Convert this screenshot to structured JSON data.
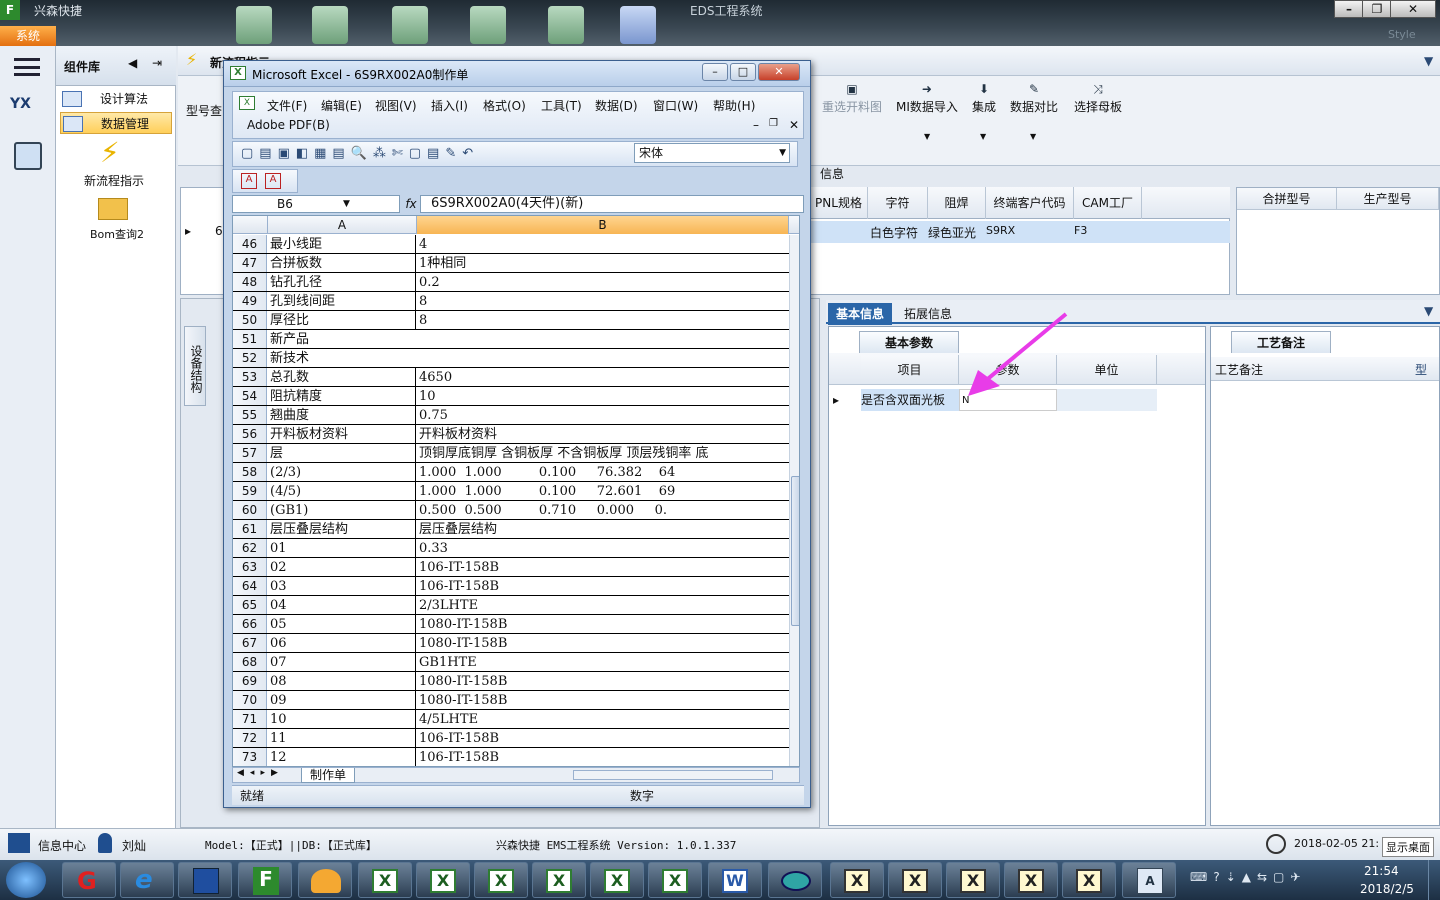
{
  "app": {
    "title": "兴森快捷",
    "center_title": "EDS工程系统",
    "system_button": "系统",
    "style_label": "Style"
  },
  "nav": {
    "library_title": "组件库",
    "items": [
      {
        "label": "设计算法"
      },
      {
        "label": "数据管理"
      }
    ],
    "new_flow": "新流程指示",
    "bom": "Bom查询2"
  },
  "main": {
    "tab_label": "新流程指示",
    "model_query": "型号查",
    "info_label": "信息",
    "ribbon": [
      {
        "label": "重选开料图",
        "icon": "image-icon",
        "disabled": true
      },
      {
        "label": "MI数据导入",
        "icon": "import-icon"
      },
      {
        "label": "集成",
        "icon": "download-icon"
      },
      {
        "label": "数据对比",
        "icon": "compare-icon"
      },
      {
        "label": "选择母板",
        "icon": "shuffle-icon"
      }
    ],
    "grid_headers": [
      "PNL规格",
      "字符",
      "阻焊",
      "终端客户代码",
      "CAM工厂"
    ],
    "grid_row": [
      "白色字符",
      "绿色亚光",
      "S9RX",
      "F3"
    ],
    "right_grid_headers": [
      "合拼型号",
      "生产型号"
    ],
    "side_tab": "设备结构",
    "row_marker_left": "6"
  },
  "detail": {
    "tabs": [
      "基本信息",
      "拓展信息"
    ],
    "left_subtab": "基本参数",
    "left_headers": [
      "项目",
      "参数",
      "单位"
    ],
    "left_row": {
      "item": "是否含双面光板",
      "param": "N",
      "unit": ""
    },
    "right_subtab": "工艺备注",
    "right_headers": [
      "工艺备注",
      "型"
    ]
  },
  "excel": {
    "title": "Microsoft Excel - 6S9RX002A0制作单",
    "menu": [
      "文件(F)",
      "编辑(E)",
      "视图(V)",
      "插入(I)",
      "格式(O)",
      "工具(T)",
      "数据(D)",
      "窗口(W)",
      "帮助(H)"
    ],
    "menu2": "Adobe PDF(B)",
    "font": "宋体",
    "namebox": "B6",
    "fx": "fx",
    "formula": "6S9RX002A0(4天件)(新)",
    "columns": [
      "A",
      "B"
    ],
    "rows": [
      {
        "n": "46",
        "a": "最小线距",
        "b": "4"
      },
      {
        "n": "47",
        "a": "合拼板数",
        "b": "1种相同"
      },
      {
        "n": "48",
        "a": "钻孔孔径",
        "b": "0.2"
      },
      {
        "n": "49",
        "a": "孔到线间距",
        "b": "8"
      },
      {
        "n": "50",
        "a": "厚径比",
        "b": "8"
      },
      {
        "n": "51",
        "a": "新产品",
        "b": "",
        "merged": true
      },
      {
        "n": "52",
        "a": "新技术",
        "b": "",
        "merged": true
      },
      {
        "n": "53",
        "a": "总孔数",
        "b": "4650"
      },
      {
        "n": "54",
        "a": "阻抗精度",
        "b": "10"
      },
      {
        "n": "55",
        "a": "翘曲度",
        "b": "0.75"
      },
      {
        "n": "56",
        "a": "开料板材资料",
        "b": "开料板材资料"
      },
      {
        "n": "57",
        "a": "层",
        "b": "顶铜厚底铜厚 含铜板厚 不含铜板厚 顶层残铜率 底"
      },
      {
        "n": "58",
        "a": "(2/3)",
        "b": "1.000  1.000         0.100     76.382    64"
      },
      {
        "n": "59",
        "a": "(4/5)",
        "b": "1.000  1.000         0.100     72.601    69"
      },
      {
        "n": "60",
        "a": "(GB1)",
        "b": "0.500  0.500         0.710     0.000     0."
      },
      {
        "n": "61",
        "a": "层压叠层结构",
        "b": "层压叠层结构"
      },
      {
        "n": "62",
        "a": "01",
        "b": "0.33"
      },
      {
        "n": "63",
        "a": "02",
        "b": "106-IT-158B"
      },
      {
        "n": "64",
        "a": "03",
        "b": "106-IT-158B"
      },
      {
        "n": "65",
        "a": "04",
        "b": "2/3LHTE"
      },
      {
        "n": "66",
        "a": "05",
        "b": "1080-IT-158B"
      },
      {
        "n": "67",
        "a": "06",
        "b": "1080-IT-158B"
      },
      {
        "n": "68",
        "a": "07",
        "b": "GB1HTE"
      },
      {
        "n": "69",
        "a": "08",
        "b": "1080-IT-158B"
      },
      {
        "n": "70",
        "a": "09",
        "b": "1080-IT-158B"
      },
      {
        "n": "71",
        "a": "10",
        "b": "4/5LHTE"
      },
      {
        "n": "72",
        "a": "11",
        "b": "106-IT-158B"
      },
      {
        "n": "73",
        "a": "12",
        "b": "106-IT-158B"
      }
    ],
    "sheet_tab": "制作单",
    "status_ready": "就绪",
    "status_num": "数字"
  },
  "footer": {
    "info_center": "信息中心",
    "user": "刘灿",
    "model_db": "Model:【正式】||DB:【正式库】",
    "version": "兴森快捷 EMS工程系统 Version: 1.0.1.337",
    "datetime": "2018-02-05 21:",
    "show_desktop": "显示桌面"
  },
  "taskbar": {
    "time": "21:54",
    "date": "2018/2/5"
  },
  "colors": {
    "accent": "#2b66a8",
    "orange": "#f7b554",
    "arrow": "#e83ce8"
  }
}
